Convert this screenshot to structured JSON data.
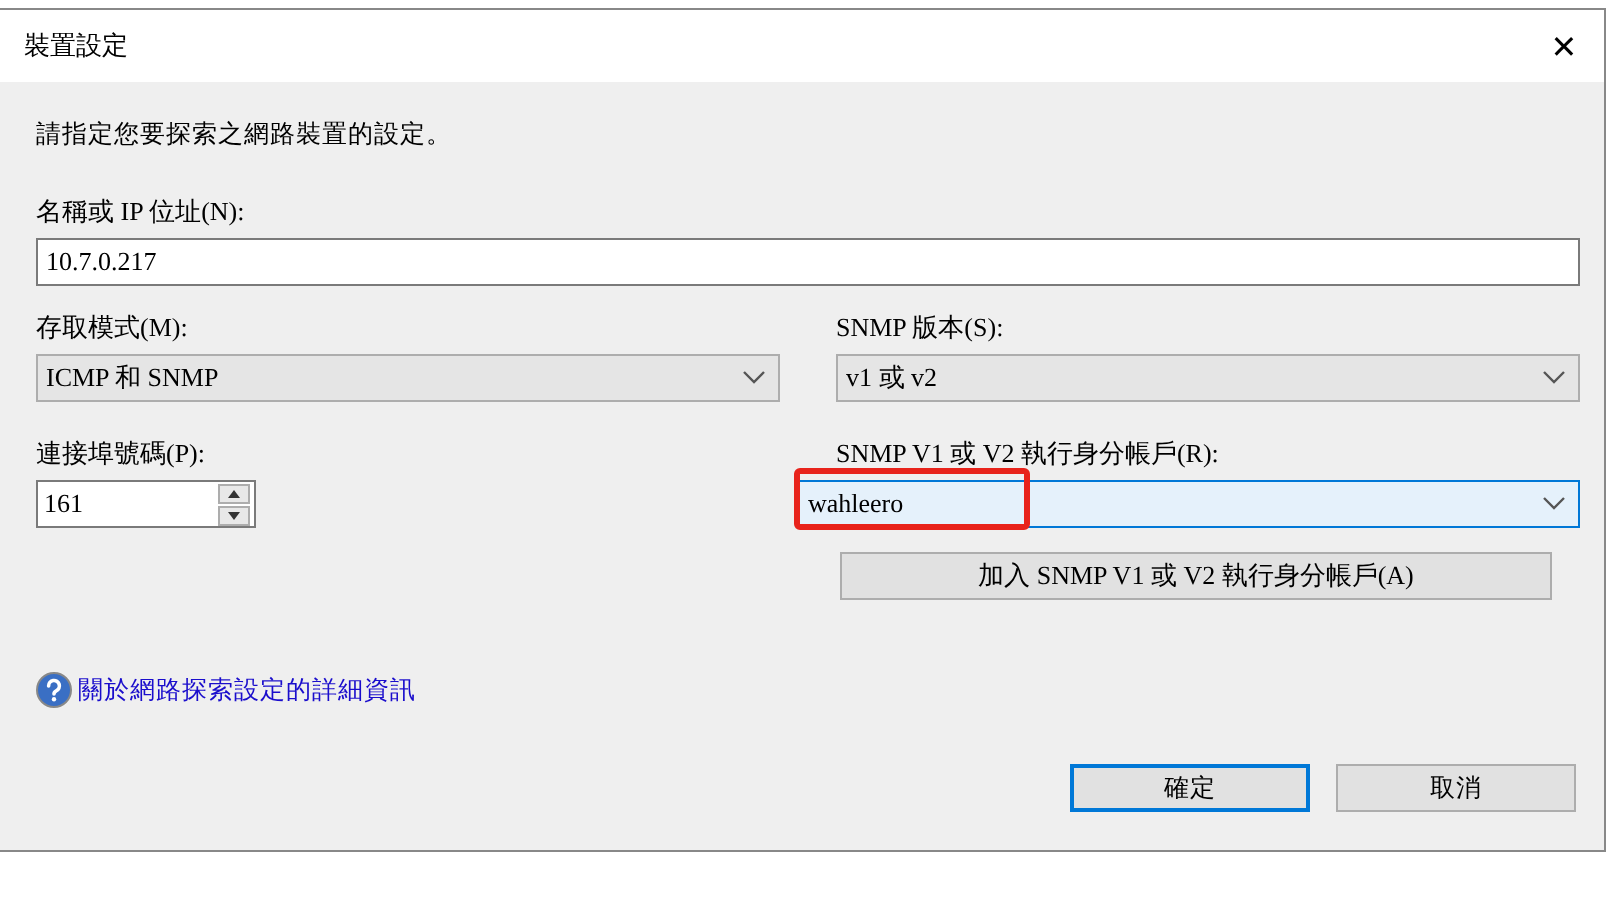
{
  "window": {
    "title": "裝置設定",
    "close": "✕"
  },
  "intro": "請指定您要探索之網路裝置的設定。",
  "name_field": {
    "label": "名稱或 IP 位址(N):",
    "value": "10.7.0.217"
  },
  "access_mode": {
    "label": "存取模式(M):",
    "value": "ICMP 和 SNMP",
    "focused": false
  },
  "snmp_version": {
    "label": "SNMP 版本(S):",
    "value": "v1 或 v2",
    "focused": false
  },
  "port": {
    "label": "連接埠號碼(P):",
    "value": "161"
  },
  "account": {
    "label": "SNMP V1 或 V2 執行身分帳戶(R):",
    "value": "wahleero",
    "focused": true,
    "highlighted": true
  },
  "add_button": "加入 SNMP V1 或 V2 執行身分帳戶(A)",
  "help_link": "關於網路探索設定的詳細資訊",
  "buttons": [
    {
      "label": "確定",
      "default": true
    },
    {
      "label": "取消",
      "default": false
    }
  ]
}
